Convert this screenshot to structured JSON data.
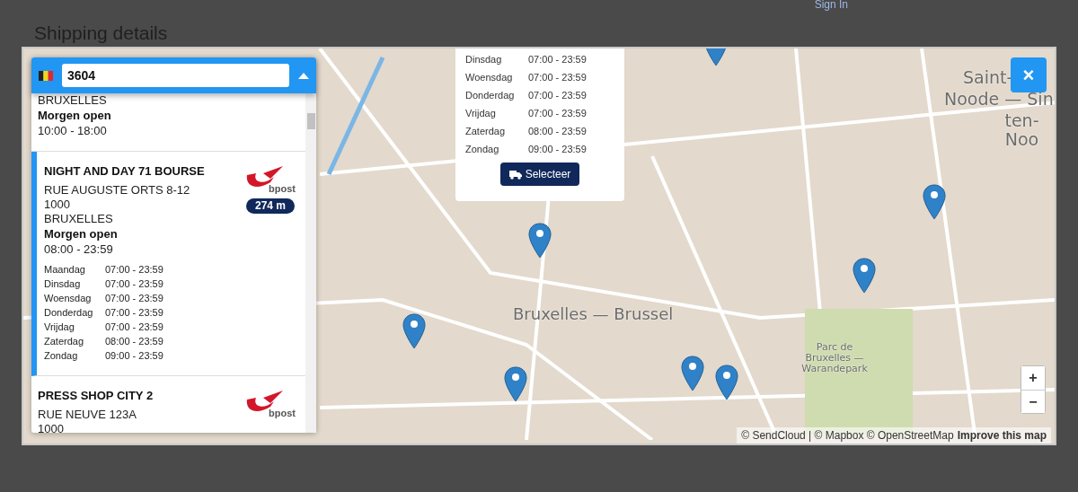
{
  "header": {
    "sign_in": "Sign In",
    "title": "Shipping details"
  },
  "search": {
    "value": "3604"
  },
  "locations": [
    {
      "selected": false,
      "address": [
        "BRUXELLES"
      ],
      "open_label": "Morgen open",
      "hours": "10:00 - 18:00"
    },
    {
      "selected": true,
      "name": "NIGHT AND DAY 71 BOURSE",
      "address": [
        "RUE AUGUSTE ORTS 8-12",
        "1000",
        "BRUXELLES"
      ],
      "carrier": "bpost",
      "distance": "274 m",
      "open_label": "Morgen open",
      "hours": "08:00 - 23:59",
      "schedule": [
        {
          "day": "Maandag",
          "time": "07:00 - 23:59"
        },
        {
          "day": "Dinsdag",
          "time": "07:00 - 23:59"
        },
        {
          "day": "Woensdag",
          "time": "07:00 - 23:59"
        },
        {
          "day": "Donderdag",
          "time": "07:00 - 23:59"
        },
        {
          "day": "Vrijdag",
          "time": "07:00 - 23:59"
        },
        {
          "day": "Zaterdag",
          "time": "08:00 - 23:59"
        },
        {
          "day": "Zondag",
          "time": "09:00 - 23:59"
        }
      ]
    },
    {
      "selected": false,
      "name": "PRESS SHOP CITY 2",
      "address": [
        "RUE NEUVE 123A",
        "1000"
      ],
      "carrier": "bpost"
    }
  ],
  "popup": {
    "schedule": [
      {
        "day": "Dinsdag",
        "time": "07:00 - 23:59"
      },
      {
        "day": "Woensdag",
        "time": "07:00 - 23:59"
      },
      {
        "day": "Donderdag",
        "time": "07:00 - 23:59"
      },
      {
        "day": "Vrijdag",
        "time": "07:00 - 23:59"
      },
      {
        "day": "Zaterdag",
        "time": "08:00 - 23:59"
      },
      {
        "day": "Zondag",
        "time": "09:00 - 23:59"
      }
    ],
    "button": "Selecteer"
  },
  "map_labels": [
    "Bruxelles — Brussel",
    "Parc de Bruxelles — Warandepark",
    "Saint-",
    "Noode — Sin",
    "ten-Noo"
  ],
  "zoom": {
    "in": "+",
    "out": "−"
  },
  "close": "×",
  "attribution": {
    "text": "© SendCloud | © Mapbox © OpenStreetMap",
    "link": "Improve this map"
  }
}
